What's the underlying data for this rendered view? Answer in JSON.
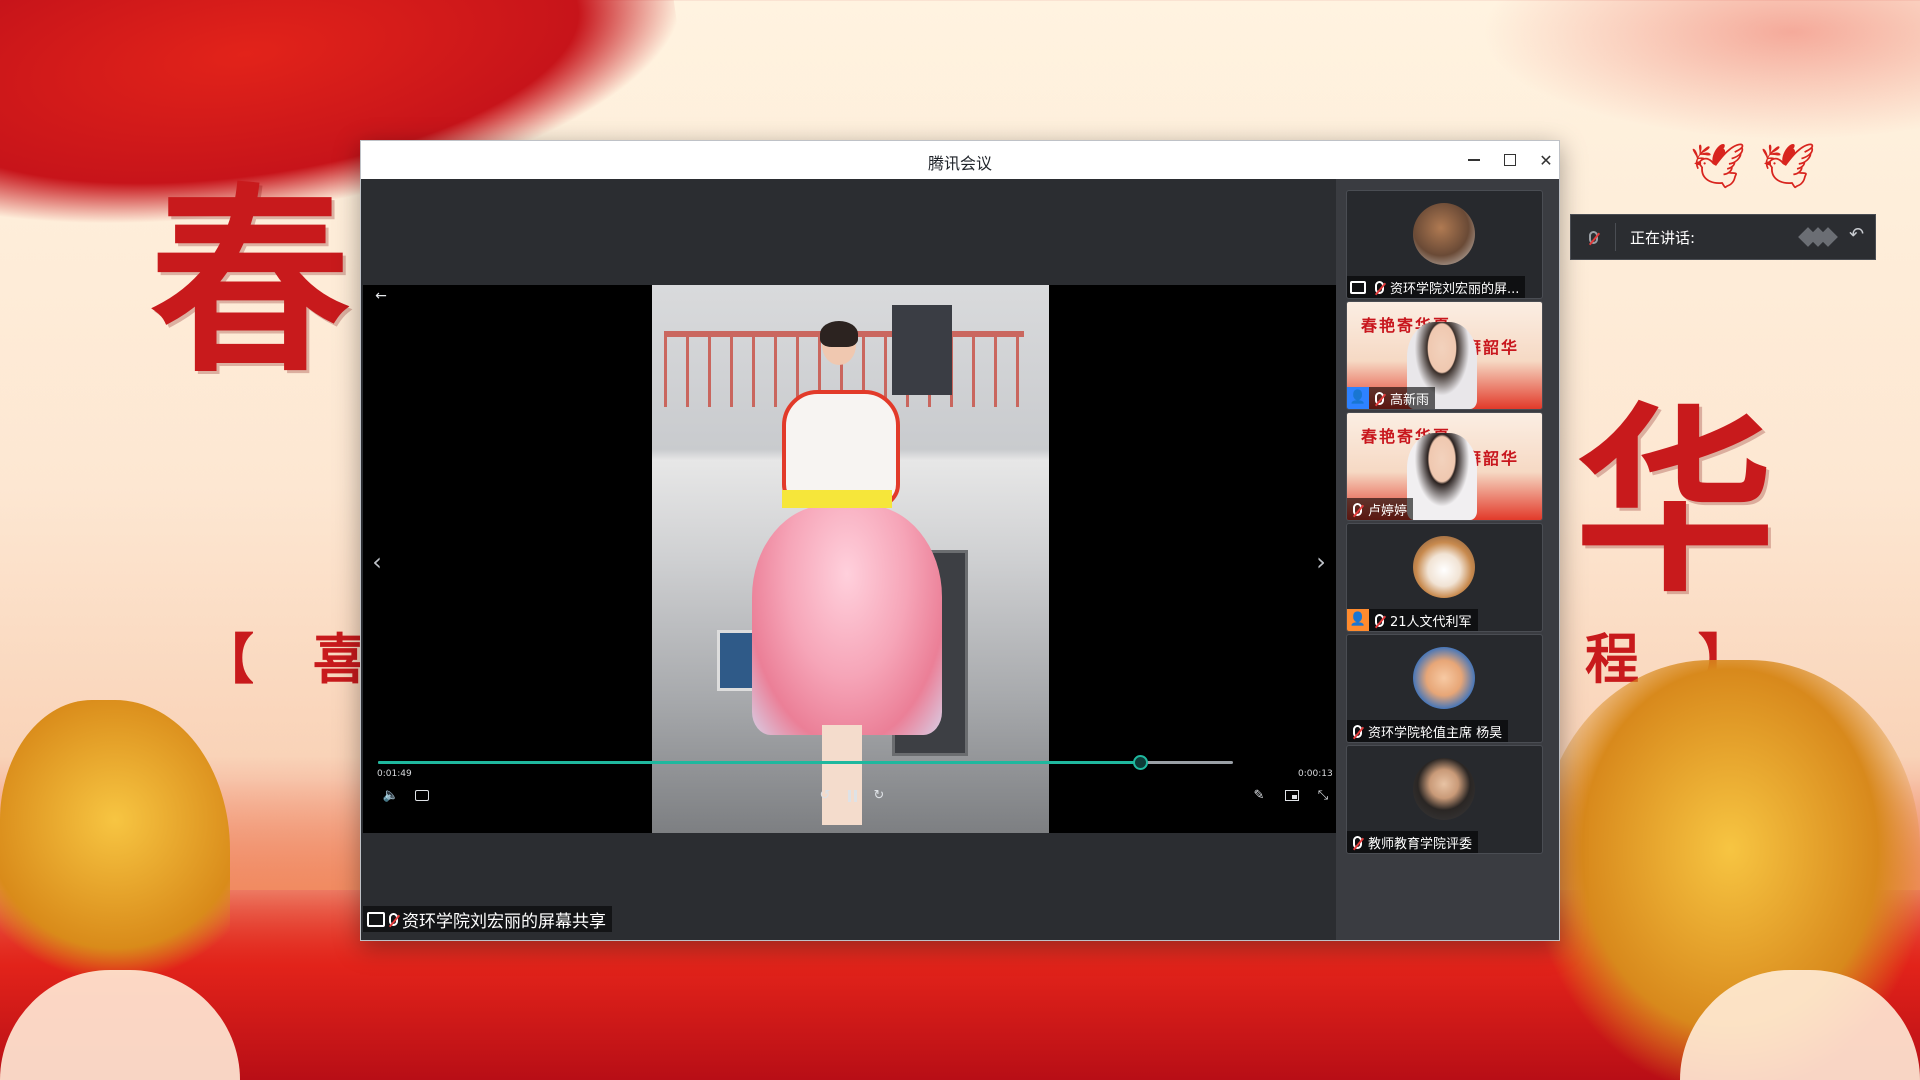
{
  "window": {
    "title": "腾讯会议",
    "minimize_icon": "minimize-icon",
    "maximize_icon": "maximize-icon",
    "close_icon": "close-icon",
    "close_glyph": "✕"
  },
  "player": {
    "time_current": "0:01:49",
    "time_total": "0:00:13",
    "progress_fraction": 0.89,
    "accent_color": "#1fb89e",
    "back_glyph": "←",
    "prev_glyph": "‹",
    "next_glyph": "›",
    "volume_glyph": "🔈",
    "rewind_glyph": "↺",
    "forward_glyph": "↻",
    "pen_glyph": "✎",
    "shrink_glyph": "⤡",
    "more_glyph": "···"
  },
  "share_label": "资环学院刘宏丽的屏幕共享",
  "participants": [
    {
      "name": "资环学院刘宏丽的屏...",
      "badge": "screen",
      "avatar": "dog-photo"
    },
    {
      "name": "高新雨",
      "badge": "user",
      "avatar": "video-feed"
    },
    {
      "name": "卢婷婷",
      "badge": "none",
      "avatar": "video-feed"
    },
    {
      "name": "21人文代利军",
      "badge": "user-orange",
      "avatar": "corgi-photo"
    },
    {
      "name": "资环学院轮值主席 杨昊",
      "badge": "none",
      "avatar": "child-photo"
    },
    {
      "name": "教师教育学院评委",
      "badge": "none",
      "avatar": "portrait-photo"
    }
  ],
  "poster_banner": {
    "line1": "春艳寄华夏",
    "line2": "澎湃韶华"
  },
  "speaking_panel": {
    "label": "正在讲话:",
    "reply_glyph": "↶"
  },
  "background": {
    "char_left": "春",
    "char_right": "华",
    "bracket_left": "【 喜",
    "bracket_right": "程 】",
    "birds": "🕊🕊"
  }
}
